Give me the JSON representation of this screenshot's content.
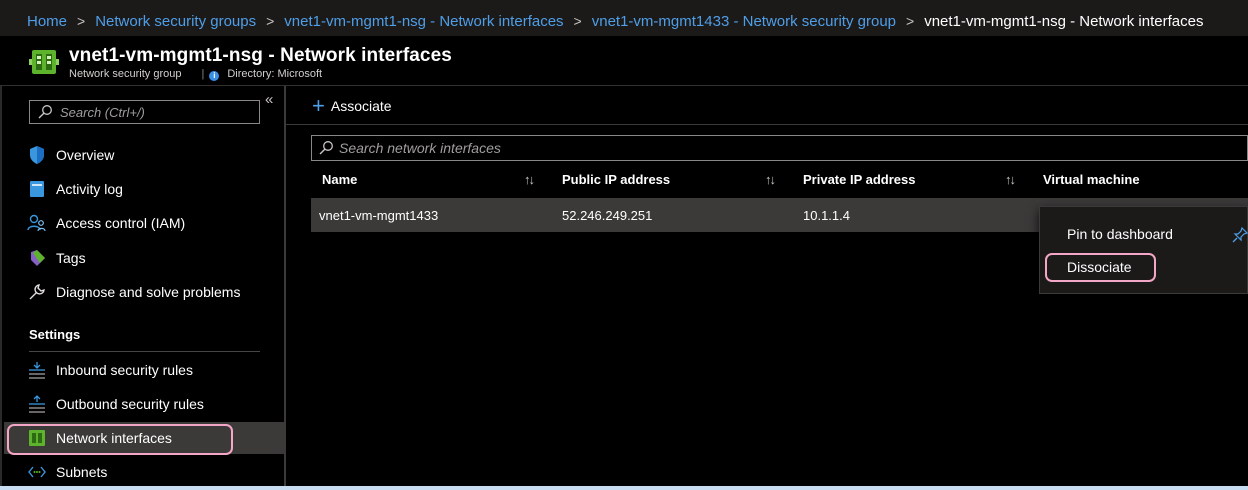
{
  "breadcrumb": {
    "items": [
      "Home",
      "Network security groups",
      "vnet1-vm-mgmt1-nsg - Network interfaces",
      "vnet1-vm-mgmt1433 - Network security group",
      "vnet1-vm-mgmt1-nsg - Network interfaces"
    ],
    "separator": ">"
  },
  "header": {
    "title": "vnet1-vm-mgmt1-nsg - Network interfaces",
    "resource_type": "Network security group",
    "directory": "Directory: Microsoft"
  },
  "sidebar": {
    "search_placeholder": "Search (Ctrl+/)",
    "collapse_glyph": "«",
    "items": [
      {
        "label": "Overview",
        "icon": "shield-icon"
      },
      {
        "label": "Activity log",
        "icon": "activity-log-icon"
      },
      {
        "label": "Access control (IAM)",
        "icon": "people-icon"
      },
      {
        "label": "Tags",
        "icon": "tag-icon"
      },
      {
        "label": "Diagnose and solve problems",
        "icon": "wrench-icon"
      }
    ],
    "settings_header": "Settings",
    "settings_items": [
      {
        "label": "Inbound security rules",
        "icon": "inbound-rules-icon"
      },
      {
        "label": "Outbound security rules",
        "icon": "outbound-rules-icon"
      },
      {
        "label": "Network interfaces",
        "icon": "network-interface-icon",
        "selected": true
      },
      {
        "label": "Subnets",
        "icon": "subnet-icon"
      }
    ]
  },
  "toolbar": {
    "associate_label": "Associate"
  },
  "grid": {
    "search_placeholder": "Search network interfaces",
    "columns": [
      "Name",
      "Public IP address",
      "Private IP address",
      "Virtual machine"
    ],
    "sort_glyph": "↑↓",
    "rows": [
      {
        "name": "vnet1-vm-mgmt1433",
        "public_ip": "52.246.249.251",
        "private_ip": "10.1.1.4",
        "vm": ""
      }
    ]
  },
  "context_menu": {
    "items": [
      "Pin to dashboard",
      "Dissociate"
    ]
  },
  "colors": {
    "accent": "#4f9ee8",
    "highlight_ring": "#f4a6c6",
    "selected_bg": "#3b3a39",
    "topbar_bg": "#1b1a19"
  }
}
